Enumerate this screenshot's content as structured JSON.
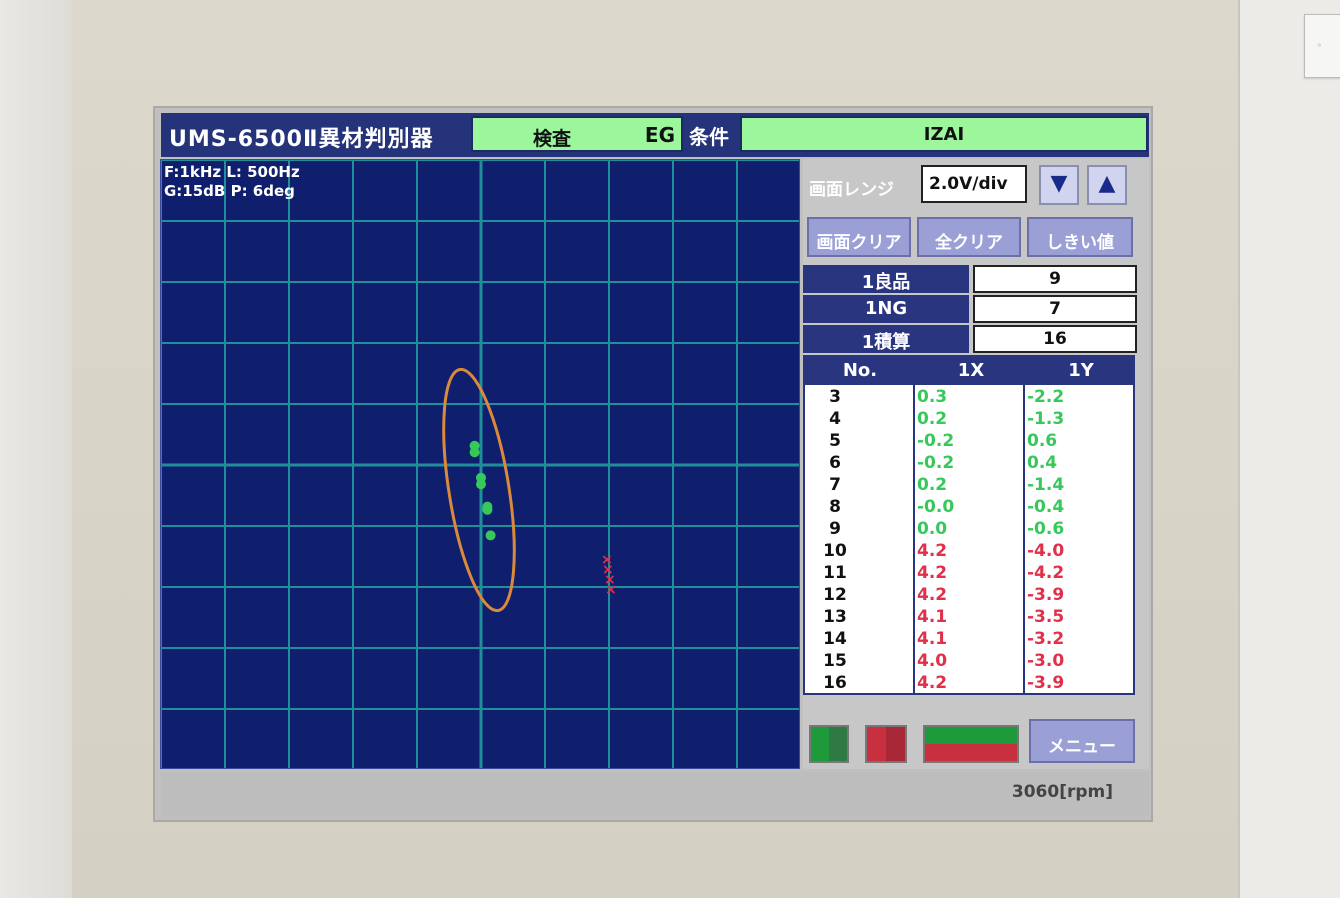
{
  "header": {
    "title": "UMS-6500Ⅱ異材判別器",
    "mode_label": "検査",
    "mode_code": "EG",
    "condition_label": "条件",
    "condition_value": "IZAI"
  },
  "plot": {
    "info_line1": "F:1kHz L: 500Hz",
    "info_line2": "G:15dB P:  6deg",
    "ellipse_color": "#d98a3a",
    "good_color": "#36c85a",
    "ng_color": "#e0304a"
  },
  "side": {
    "range_label": "画面レンジ",
    "range_value": "2.0V/div",
    "down_icon": "▼",
    "up_icon": "▲",
    "buttons": [
      "画面クリア",
      "全クリア",
      "しきい値"
    ],
    "stats": [
      {
        "label": "1良品",
        "value": "9"
      },
      {
        "label": "1NG",
        "value": "7"
      },
      {
        "label": "1積算",
        "value": "16"
      }
    ],
    "table": {
      "headers": [
        "No.",
        "1X",
        "1Y"
      ],
      "rows": [
        {
          "no": "3",
          "x": "0.3",
          "y": "-2.2",
          "status": "good"
        },
        {
          "no": "4",
          "x": "0.2",
          "y": "-1.3",
          "status": "good"
        },
        {
          "no": "5",
          "x": "-0.2",
          "y": "0.6",
          "status": "good"
        },
        {
          "no": "6",
          "x": "-0.2",
          "y": "0.4",
          "status": "good"
        },
        {
          "no": "7",
          "x": "0.2",
          "y": "-1.4",
          "status": "good"
        },
        {
          "no": "8",
          "x": "-0.0",
          "y": "-0.4",
          "status": "good"
        },
        {
          "no": "9",
          "x": "0.0",
          "y": "-0.6",
          "status": "good"
        },
        {
          "no": "10",
          "x": "4.2",
          "y": "-4.0",
          "status": "ng"
        },
        {
          "no": "11",
          "x": "4.2",
          "y": "-4.2",
          "status": "ng"
        },
        {
          "no": "12",
          "x": "4.2",
          "y": "-3.9",
          "status": "ng"
        },
        {
          "no": "13",
          "x": "4.1",
          "y": "-3.5",
          "status": "ng"
        },
        {
          "no": "14",
          "x": "4.1",
          "y": "-3.2",
          "status": "ng"
        },
        {
          "no": "15",
          "x": "4.0",
          "y": "-3.0",
          "status": "ng"
        },
        {
          "no": "16",
          "x": "4.2",
          "y": "-3.9",
          "status": "ng"
        }
      ]
    },
    "menu_label": "メニュー"
  },
  "status": {
    "rpm": "3060[rpm]"
  }
}
